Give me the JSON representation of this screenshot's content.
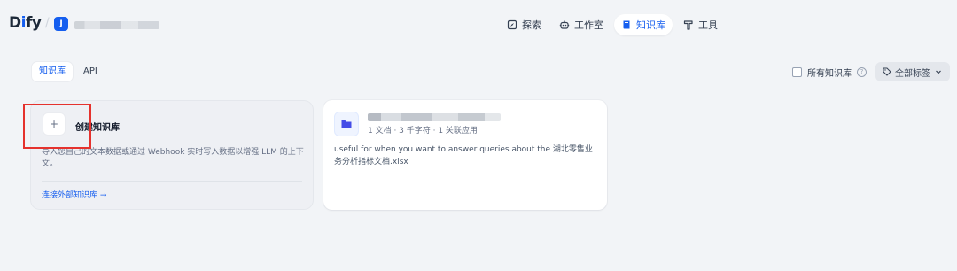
{
  "header": {
    "logo_prefix": "D",
    "logo_accent": "i",
    "logo_suffix": "fy",
    "workspace_initial": "J",
    "nav": [
      {
        "label": "探索",
        "icon": "explore-icon"
      },
      {
        "label": "工作室",
        "icon": "robot-icon"
      },
      {
        "label": "知识库",
        "icon": "book-icon",
        "active": true
      },
      {
        "label": "工具",
        "icon": "hammer-icon"
      }
    ]
  },
  "tabs": [
    {
      "label": "知识库",
      "active": true
    },
    {
      "label": "API",
      "active": false
    }
  ],
  "filters": {
    "all_kb_label": "所有知识库",
    "tag_label": "全部标签"
  },
  "create_card": {
    "plus": "+",
    "title": "创建知识库",
    "description": "导入您自己的文本数据或通过 Webhook 实时写入数据以增强 LLM 的上下文。",
    "link": "连接外部知识库 →"
  },
  "dataset_card": {
    "meta": "1 文档 · 3 千字符 · 1 关联应用",
    "description": "useful for when you want to answer queries about the 湖北零售业务分析指标文档.xlsx"
  },
  "colors": {
    "accent": "#155eef",
    "highlight": "#e5322d",
    "background": "#f2f4f7"
  }
}
